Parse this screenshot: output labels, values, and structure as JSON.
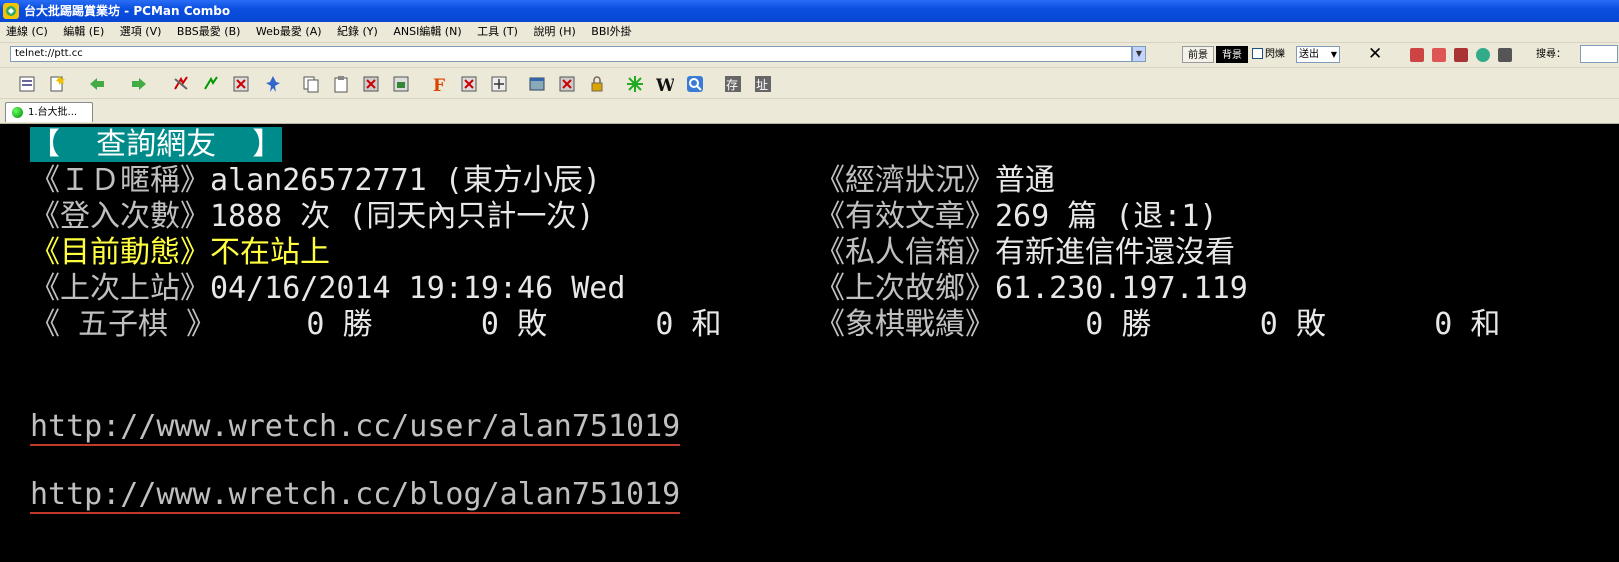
{
  "window": {
    "title": "台大批踢踢賞業坊 - PCMan Combo"
  },
  "menu": [
    "連線 (C)",
    "編輯 (E)",
    "選項 (V)",
    "BBS最愛 (B)",
    "Web最愛 (A)",
    "紀錄 (Y)",
    "ANSI編輯 (N)",
    "工具 (T)",
    "說明 (H)",
    "BBI外掛"
  ],
  "address": {
    "value": "telnet://ptt.cc",
    "front_label": "前景",
    "back_label": "背景",
    "blink_label": "閃爍",
    "send_label": "送出",
    "search_label": "搜尋："
  },
  "tab": {
    "label": "1.台大批..."
  },
  "terminal": {
    "header": "【  查詢網友  】",
    "rows": [
      {
        "left_label": "《ＩＤ暱稱》",
        "left_value": "alan26572771 (東方小辰)",
        "right_label": "《經濟狀況》",
        "right_value": "普通"
      },
      {
        "left_label": "《登入次數》",
        "left_value": "1888 次 (同天內只計一次)",
        "right_label": "《有效文章》",
        "right_value": "269 篇 (退:1)"
      },
      {
        "left_label": "《目前動態》",
        "left_value": "不在站上",
        "right_label": "《私人信箱》",
        "right_value": "有新進信件還沒看"
      },
      {
        "left_label": "《上次上站》",
        "left_value": "04/16/2014 19:19:46 Wed",
        "right_label": "《上次故鄉》",
        "right_value": "61.230.197.119"
      }
    ],
    "games": {
      "gomoku_label": "《 五子棋 》",
      "gomoku_record": "     0 勝      0 敗      0 和",
      "chess_label": "《象棋戰績》",
      "chess_record": "     0 勝      0 敗      0 和"
    },
    "urls": [
      "http://www.wretch.cc/user/alan751019",
      "http://www.wretch.cc/blog/alan751019"
    ]
  }
}
